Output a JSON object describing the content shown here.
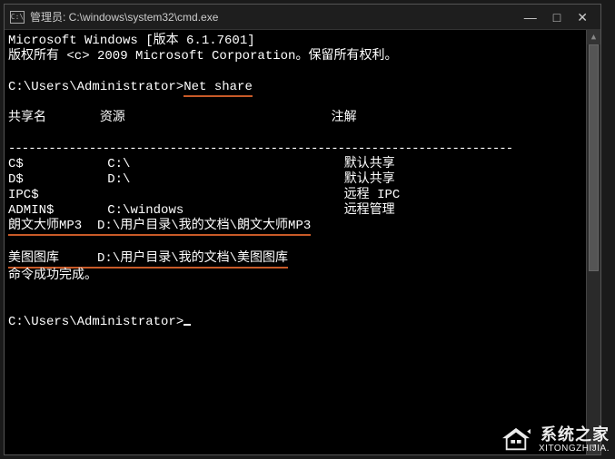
{
  "titlebar": {
    "icon_label": "C:\\",
    "title": "管理员: C:\\windows\\system32\\cmd.exe"
  },
  "term": {
    "ms_line": "Microsoft Windows [版本 6.1.7601]",
    "copyright": "版权所有 <c> 2009 Microsoft Corporation。保留所有权利。",
    "prompt1_path": "C:\\Users\\Administrator>",
    "cmd1": "Net share",
    "hdr_share": "共享名",
    "hdr_resource": "资源",
    "hdr_comment": "注解",
    "row_c_name": "C$",
    "row_c_res": "C:\\",
    "row_c_com": "默认共享",
    "row_d_name": "D$",
    "row_d_res": "D:\\",
    "row_d_com": "默认共享",
    "row_ipc_name": "IPC$",
    "row_ipc_com": "远程 IPC",
    "row_admin_name": "ADMIN$",
    "row_admin_res": "C:\\windows",
    "row_admin_com": "远程管理",
    "row_mp3_name": "朗文大师MP3",
    "row_mp3_res": "D:\\用户目录\\我的文档\\朗文大师MP3",
    "row_pic_name": "美图图库",
    "row_pic_res": "D:\\用户目录\\我的文档\\美图图库",
    "done": "命令成功完成。",
    "prompt2_path": "C:\\Users\\Administrator>",
    "hr": "---------------------------------------------------------------------------"
  },
  "watermark": {
    "title": "系统之家",
    "url": "XITONGZHIJIA."
  }
}
